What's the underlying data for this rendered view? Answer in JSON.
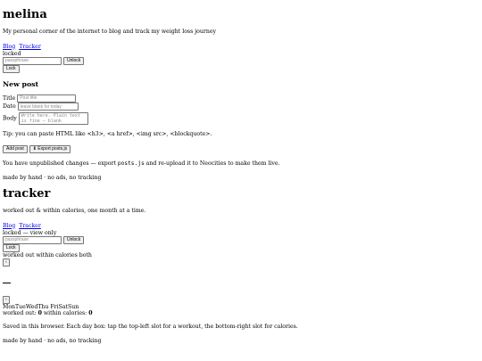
{
  "blog": {
    "title": "melina",
    "tagline": "My personal corner of the internet to blog and track my weight loss journey",
    "nav": {
      "blog": "Blog",
      "tracker": "Tracker"
    },
    "status": "locked",
    "passphrase_placeholder": "passphrase",
    "unlock_label": "Unlock",
    "lock_label": "Lock",
    "new_post": {
      "heading": "New post",
      "title_label": "Title",
      "title_placeholder": "Post title",
      "date_label": "Date",
      "date_placeholder": "leave blank for today",
      "body_label": "Body",
      "body_placeholder": "Write here. Plain text is fine — blank"
    },
    "tip": "Tip: you can paste HTML like <h3>, <a href>, <img src>, <blockquote>.",
    "add_post_label": "Add post",
    "export_label": "⬇ Export posts.js",
    "unpublished": {
      "prefix": "You have unpublished changes — export ",
      "filename": "posts.js",
      "suffix": " and re-upload it to Neocities to make them live."
    },
    "footer": "made by hand · no ads, no tracking"
  },
  "tracker": {
    "title": "tracker",
    "tagline": "worked out & within calories, one month at a time.",
    "nav": {
      "blog": "Blog",
      "tracker": "Tracker"
    },
    "status": "locked — view only",
    "passphrase_placeholder": "passphrase",
    "unlock_label": "Unlock",
    "lock_label": "Lock",
    "legend": "worked out within calories both",
    "prev_label": "‹",
    "month_title": "",
    "next_label": "›",
    "weekdays_part1": "MonTueWedThu",
    "weekdays_part2": "FriSatSun",
    "counts": {
      "worked_out_label": "worked out: ",
      "worked_out_value": "0",
      "within_label": " within calories: ",
      "within_value": "0"
    },
    "saved_note": "Saved in this browser. Each day box: tap the top-left slot for a workout, the bottom-right slot for calories.",
    "footer": "made by hand · no ads, no tracking"
  }
}
